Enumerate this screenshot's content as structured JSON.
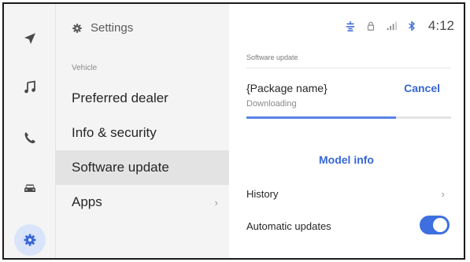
{
  "rail": {
    "items": [
      {
        "name": "navigation-icon"
      },
      {
        "name": "music-icon"
      },
      {
        "name": "phone-icon"
      },
      {
        "name": "car-icon"
      },
      {
        "name": "settings-gear-icon",
        "active": true
      }
    ]
  },
  "settings": {
    "header_title": "Settings",
    "section_label": "Vehicle",
    "menu": [
      {
        "label": "Preferred dealer"
      },
      {
        "label": "Info & security"
      },
      {
        "label": "Software update",
        "selected": true
      },
      {
        "label": "Apps",
        "has_chevron": true
      }
    ]
  },
  "status_bar": {
    "icons": [
      "steering-wheel-icon",
      "lock-icon",
      "signal-icon",
      "bluetooth-icon"
    ],
    "time": "4:12"
  },
  "update": {
    "section_title": "Software update",
    "package_name": "{Package name}",
    "status": "Downloading",
    "cancel_label": "Cancel",
    "progress_fraction": 0.73,
    "model_info_label": "Model info",
    "history_label": "History",
    "auto_updates_label": "Automatic updates",
    "auto_updates_on": true
  },
  "colors": {
    "accent": "#3766d6",
    "toggle": "#3d6fe0",
    "rail_active": "#d9e4fb"
  }
}
